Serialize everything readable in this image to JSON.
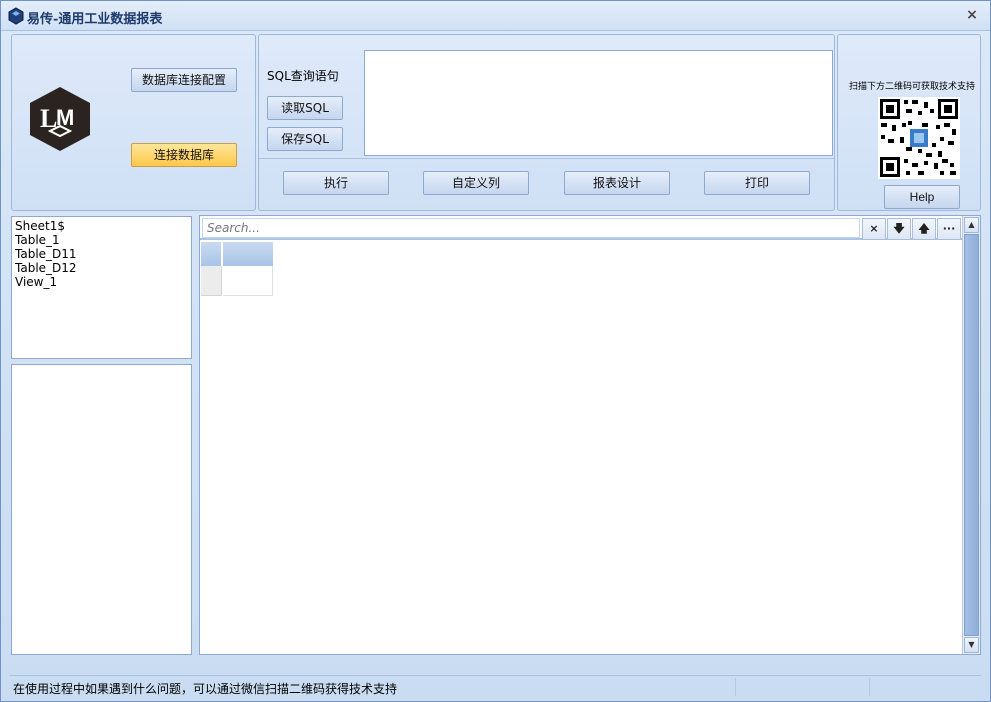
{
  "window": {
    "title": "易传-通用工业数据报表",
    "close_glyph": "×"
  },
  "logo": {
    "text": "LM",
    "colors": {
      "dark": "#2b2320",
      "light": "#ffffff"
    }
  },
  "connection": {
    "config_button": "数据库连接配置",
    "connect_button": "连接数据库"
  },
  "sql": {
    "label": "SQL查询语句",
    "read_button": "读取SQL",
    "save_button": "保存SQL",
    "query_text": ""
  },
  "actions": {
    "execute": "执行",
    "custom_column": "自定义列",
    "report_design": "报表设计",
    "print": "打印"
  },
  "support": {
    "caption": "扫描下方二维码可获取技术支持",
    "help_button": "Help"
  },
  "tables": {
    "items": [
      "Sheet1$",
      "Table_1",
      "Table_D11",
      "Table_D12",
      "View_1"
    ]
  },
  "grid": {
    "search_placeholder": "Search...",
    "clear_icon": "×",
    "down_icon": "🡇",
    "up_icon": "🡅",
    "more_icon": "···"
  },
  "status": {
    "message": "在使用过程中如果遇到什么问题，可以通过微信扫描二维码获得技术支持"
  },
  "colors": {
    "accent_orange": "#ffc84a",
    "header_blue": "#a8c4e6",
    "panel_bg": "#d6e4f6"
  }
}
